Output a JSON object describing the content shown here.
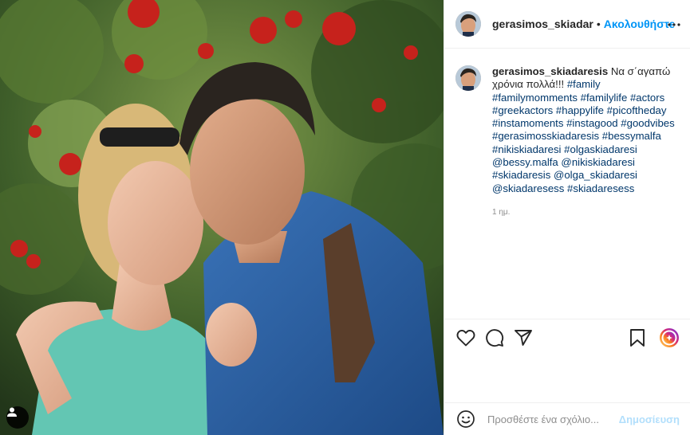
{
  "colors": {
    "accent": "#0095f6",
    "post_button_disabled": "#b2dffc",
    "hashtag": "#00376b",
    "muted": "#8e8e8e"
  },
  "photo": {
    "user_tag_icon": "user-tag-icon"
  },
  "header": {
    "username": "gerasimos_skiadar",
    "separator": "•",
    "follow_label": "Ακολουθήστε",
    "more_icon": "more-options-icon"
  },
  "caption": {
    "username": "gerasimos_skiadaresis",
    "text": "Να σ΄αγαπώ χρόνια πολλά!!!",
    "hashtags": "#family #familymomments #familylife #actors #greekactors #happylife #picoftheday #instamoments #instagood #goodvibes #gerasimosskiadaresis #bessymalfa #nikiskiadaresi #olgaskiadaresi @bessy.malfa @nikiskiadaresi #skiadaresis @olga_skiadaresi @skiadaresess #skiadaresess",
    "time": "1 ημ."
  },
  "actions": {
    "like_icon": "heart-icon",
    "comment_icon": "comment-icon",
    "share_icon": "share-icon",
    "save_icon": "bookmark-icon"
  },
  "comment": {
    "placeholder": "Προσθέστε ένα σχόλιο...",
    "post_label": "Δημοσίευση"
  }
}
